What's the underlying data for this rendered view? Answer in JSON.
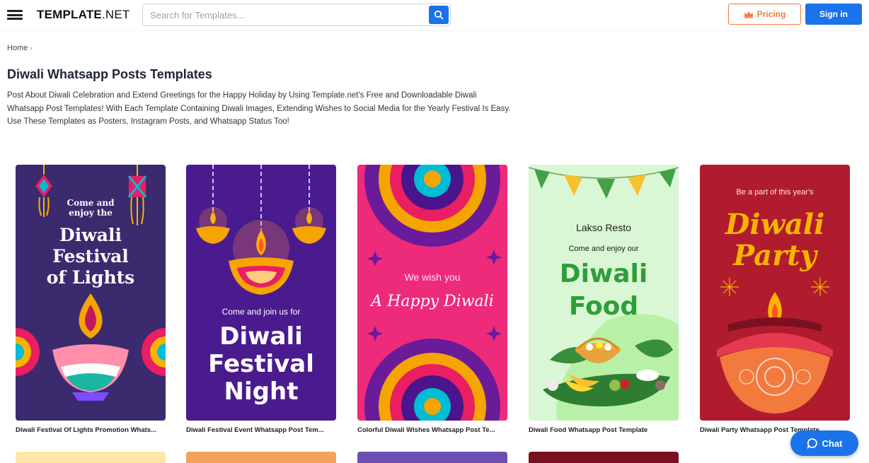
{
  "header": {
    "logo_bold": "TEMPLATE",
    "logo_light": ".NET",
    "search_placeholder": "Search for Templates...",
    "pricing_label": "Pricing",
    "signin_label": "Sign in"
  },
  "breadcrumb": {
    "home": "Home",
    "separator": "›"
  },
  "page": {
    "title": "Diwali Whatsapp Posts Templates",
    "description_lines": [
      "Post About Diwali Celebration and Extend Greetings for the Happy Holiday by Using Template.net's Free and Downloadable Diwali",
      "Whatsapp Post Templates! With Each Template Containing Diwali Images, Extending Wishes to Social Media for the Yearly Festival Is Easy.",
      "Use These Templates as Posters, Instagram Posts, and Whatsapp Status Too!"
    ]
  },
  "cards": [
    {
      "title": "Diwali Festival Of Lights Promotion Whats...",
      "lines": [
        "Come and",
        "enjoy the",
        "Diwali",
        "Festival",
        "of Lights"
      ],
      "bg": "#3b2a6e"
    },
    {
      "title": "Diwali Festival Event Whatsapp Post Tem...",
      "lines": [
        "Come and join us for",
        "Diwali",
        "Festival",
        "Night"
      ],
      "bg": "#4a1b8f"
    },
    {
      "title": "Colorful Diwali Wishes Whatsapp Post Te...",
      "lines": [
        "We wish you",
        "A Happy Diwali"
      ],
      "bg": "#ee2a7b"
    },
    {
      "title": "Diwali Food Whatsapp Post Template",
      "lines": [
        "Lakso Resto",
        "Come and enjoy our",
        "Diwali",
        "Food"
      ],
      "bg": "#d9f7d4"
    },
    {
      "title": "Diwali Party Whatsapp Post Template",
      "lines": [
        "Be a part of this year's",
        "Diwali",
        "Party"
      ],
      "bg": "#b01c2e"
    }
  ],
  "chat": {
    "label": "Chat"
  },
  "colors": {
    "brand_blue": "#1a73e8",
    "pricing_orange": "#f07b3f"
  }
}
